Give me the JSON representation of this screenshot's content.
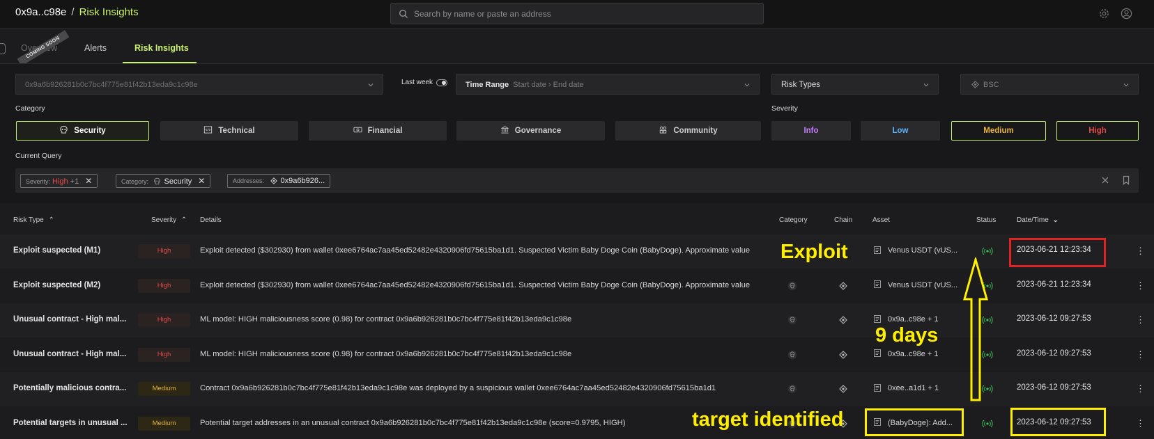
{
  "header": {
    "address_short": "0x9a..c98e",
    "separator": "/",
    "current_page": "Risk Insights",
    "search_placeholder": "Search by name or paste an address"
  },
  "tabs": {
    "overview": "Overview",
    "coming_soon": "COMING SOON",
    "alerts": "Alerts",
    "risk_insights": "Risk Insights"
  },
  "filters": {
    "address_value": "0x9a6b926281b0c7bc4f775e81f42b13eda9c1c98e",
    "last_week_label": "Last week",
    "time_range_label": "Time Range",
    "start_date": "Start date",
    "end_date": "End date",
    "risk_types": "Risk Types",
    "chain": "BSC"
  },
  "category": {
    "label": "Category",
    "items": [
      "Security",
      "Technical",
      "Financial",
      "Governance",
      "Community"
    ],
    "selected": "Security"
  },
  "severity": {
    "label": "Severity",
    "items": [
      {
        "label": "Info",
        "color": "#c77dff"
      },
      {
        "label": "Low",
        "color": "#5ab4ff"
      },
      {
        "label": "Medium",
        "color": "#e9b43c"
      },
      {
        "label": "High",
        "color": "#e24a4a"
      }
    ]
  },
  "current_query": {
    "label": "Current Query",
    "severity_key": "Severity:",
    "severity_value": "High",
    "severity_more": "+1",
    "category_key": "Category:",
    "category_value": "Security",
    "addresses_key": "Addresses:",
    "addresses_value": "0x9a6b926..."
  },
  "table": {
    "headers": {
      "risk_type": "Risk Type",
      "severity": "Severity",
      "details": "Details",
      "category": "Category",
      "chain": "Chain",
      "asset": "Asset",
      "status": "Status",
      "datetime": "Date/Time"
    },
    "rows": [
      {
        "type": "Exploit suspected (M1)",
        "severity": "High",
        "details": "Exploit detected ($302930) from wallet 0xee6764ac7aa45ed52482e4320906fd75615ba1d1. Suspected Victim Baby Doge Coin (BabyDoge). Approximate value",
        "asset": "Venus USDT (vUS...",
        "date": "2023-06-21 12:23:34"
      },
      {
        "type": "Exploit suspected (M2)",
        "severity": "High",
        "details": "Exploit detected ($302930) from wallet 0xee6764ac7aa45ed52482e4320906fd75615ba1d1. Suspected Victim Baby Doge Coin (BabyDoge). Approximate value",
        "asset": "Venus USDT (vUS...",
        "date": "2023-06-21 12:23:34"
      },
      {
        "type": "Unusual contract - High mal...",
        "severity": "High",
        "details": "ML model: HIGH maliciousness score (0.98) for contract 0x9a6b926281b0c7bc4f775e81f42b13eda9c1c98e",
        "asset": "0x9a..c98e + 1",
        "date": "2023-06-12 09:27:53"
      },
      {
        "type": "Unusual contract - High mal...",
        "severity": "High",
        "details": "ML model: HIGH maliciousness score (0.98) for contract 0x9a6b926281b0c7bc4f775e81f42b13eda9c1c98e",
        "asset": "0x9a..c98e + 1",
        "date": "2023-06-12 09:27:53"
      },
      {
        "type": "Potentially malicious contra...",
        "severity": "Medium",
        "details": "Contract 0x9a6b926281b0c7bc4f775e81f42b13eda9c1c98e was deployed by a suspicious wallet 0xee6764ac7aa45ed52482e4320906fd75615ba1d1",
        "asset": "0xee..a1d1 + 1",
        "date": "2023-06-12 09:27:53"
      },
      {
        "type": "Potential targets in unusual ...",
        "severity": "Medium",
        "details": "Potential target addresses in an unusual contract 0x9a6b926281b0c7bc4f775e81f42b13eda9c1c98e (score=0.9795, HIGH)",
        "asset": "(BabyDoge): Add...",
        "date": "2023-06-12 09:27:53"
      }
    ]
  },
  "annotations": {
    "exploit": "Exploit",
    "days": "9 days",
    "target": "target identified",
    "color": "#ffee00",
    "red_box_color": "#e02424"
  },
  "colors": {
    "accent": "#c9f26b",
    "background": "#1c1c1e",
    "high": "#e24a4a",
    "medium": "#e9b43c",
    "status_green": "#3fbf5a"
  }
}
